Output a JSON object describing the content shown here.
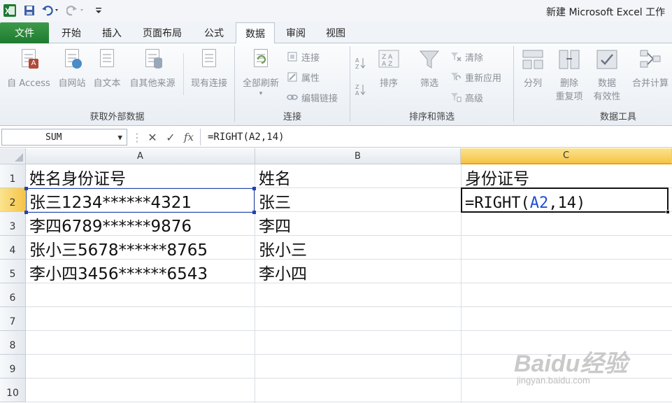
{
  "window": {
    "title": "新建 Microsoft Excel 工作"
  },
  "qat": {
    "icons": [
      "excel-logo-icon",
      "save-icon",
      "undo-icon",
      "redo-icon",
      "customize-icon"
    ]
  },
  "tabs": {
    "file": "文件",
    "items": [
      {
        "label": "开始"
      },
      {
        "label": "插入"
      },
      {
        "label": "页面布局"
      },
      {
        "label": "公式"
      },
      {
        "label": "数据",
        "active": true
      },
      {
        "label": "审阅"
      },
      {
        "label": "视图"
      }
    ]
  },
  "ribbon": {
    "get_external": {
      "label": "获取外部数据",
      "buttons": [
        "自 Access",
        "自网站",
        "自文本",
        "自其他来源",
        "现有连接"
      ]
    },
    "connections": {
      "label": "连接",
      "refresh": "全部刷新",
      "small": [
        "连接",
        "属性",
        "编辑链接"
      ]
    },
    "sort_filter": {
      "label": "排序和筛选",
      "sort": "排序",
      "filter": "筛选",
      "small": [
        "清除",
        "重新应用",
        "高级"
      ]
    },
    "data_tools": {
      "label": "数据工具",
      "buttons": [
        "分列",
        "删除\n重复项",
        "数据\n有效性",
        "合并计算"
      ],
      "split": "分列",
      "remove_dup_1": "删除",
      "remove_dup_2": "重复项",
      "validation_1": "数据",
      "validation_2": "有效性",
      "consolidate": "合并计算"
    }
  },
  "formula_bar": {
    "name_box": "SUM",
    "cancel": "✕",
    "enter": "✓",
    "fx": "fx",
    "formula": "=RIGHT(A2,14)"
  },
  "sheet": {
    "columns": [
      "A",
      "B",
      "C"
    ],
    "active_column": "C",
    "active_row": "2",
    "rows": [
      "1",
      "2",
      "3",
      "4",
      "5",
      "6",
      "7",
      "8",
      "9",
      "10"
    ],
    "cells": {
      "A1": "姓名身份证号",
      "B1": "姓名",
      "C1": "身份证号",
      "A2": "张三1234******4321",
      "B2": "张三",
      "C2_prefix": "=RIGHT(",
      "C2_ref": "A2",
      "C2_suffix": ",14)",
      "A3": "李四6789******9876",
      "B3": "李四",
      "A4": "张小三5678******8765",
      "B4": "张小三",
      "A5": "李小四3456******6543",
      "B5": "李小四"
    }
  },
  "watermark": {
    "line1": "Baidu经验",
    "line2": "jingyan.baidu.com"
  },
  "colors": {
    "file_tab": "#1e7b2f",
    "active_header": "#f5c447",
    "ref_blue": "#1f4fd1"
  }
}
